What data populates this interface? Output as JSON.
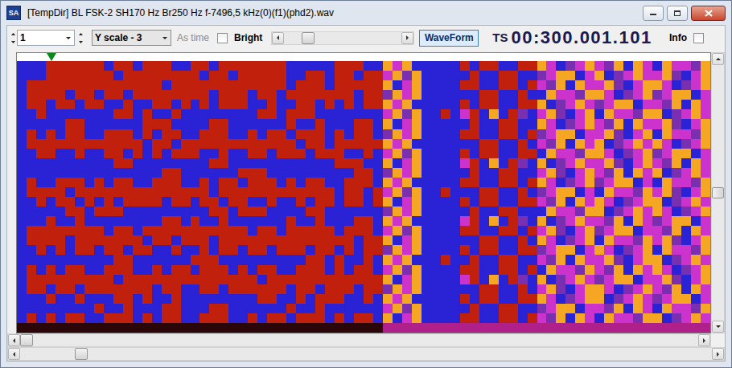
{
  "window": {
    "title": "[TempDir] BL FSK-2 SH170 Hz Br250 Hz f-7496,5 kHz(0)(f1)(phd2).wav",
    "app_logo": "SA"
  },
  "toolbar": {
    "channel": {
      "value": "1"
    },
    "scale": {
      "value": "Y scale - 3"
    },
    "as_time": {
      "label": "As time",
      "disabled": true
    },
    "bright": {
      "label": "Bright",
      "checked": false
    },
    "slider": {
      "level": 0.17
    },
    "waveform": {
      "label": "WaveForm",
      "selected": true
    },
    "ts": {
      "label": "TS",
      "value": "00:300.001.101"
    },
    "info": {
      "label": "Info",
      "checked": false
    }
  },
  "plot": {
    "marker": {
      "level": 0.05
    },
    "palette": {
      "R": "#c0200c",
      "B": "#2a23d6",
      "Y": "#f5a623",
      "M": "#cc33cc",
      "P": "#7a2fb0",
      "K": "#2a0608",
      "m": "#b0208a"
    },
    "rows": [
      "BBB RRRRR RBRRB RRRBB RRBRR RRRRR BBBBB RRRBB YMYB BBBB RBRRBBRR YMBPMY MPYBYM BYMMPY",
      "BBB RRRRR RRBRR RRRRR RBRRB RRRRR BBRRB RRBRR MYPY BBBB BRBBRRBB PMYYBM YBPMYM MYPBMY",
      "BRR RRRRR RRRRR RRBRR RRRRR RRRRR BRRRB RRRRR YBMY BBBB RRBBRRBR MPYBYM MYPBMY YMBPMY",
      "BRR RRBRR BRRBR RRRRR RRBRR RBRRB RRRRR RRBRR PYMY BBBB BBRRBBRB BYMMPY YMBPMY PMYYBM",
      "BRR BRRBR RBBRB BRRBR BRBRR RBBRB BRRBR BRBRR YMYB BBBB RBRRBBRR YBPMYM PMYYBM MPYBYM",
      "BBR BBBBB BBRRB RBBRB BBBBB BBRRB RRRBB BBBBB MYPY BBRB MRBYBRPB MYPBMY BYMMPY YBPMYM",
      "BBB BBRRB BBBBB RRRBB BBRRB BBBBB RBBRB BBRRB YBMY BBBB BRBBRRBB YMBPMY MPYBYM MYPBMY",
      "BRB RBRRB BRRRB RBRRB BRRRB BRBRR BRRRB RBRRB PYMY BBBB RRBBRRBR PMYYBM MYPBMY BYMMPY",
      "BRR RRRRR RRRRR BRRBR RRRRR RRRRR RBRRB RRRRR YMYB BBBB BBRRBBRB MPYBYM YBPMYM YMBPMY",
      "BBR RBBRB BRRBR BRBRR RBBRB BRRBR RRBRR RBBRB MYPY BBBB RBRRBBRR BYMMPY YMBPMY PMYYBM",
      "BBB BBBBB BBRRB BBBBB BBRRB BBBBB BBBBB RRRBB YBMY BBBB MRBYBRPB YBPMYM MYPBMY MPYBYM",
      "BBB BBBBB BBBBB BBRRB BBBBB RRRBB BBBBB BBRRB PYMY BBBB BRBBRRBB MYPBMY MPYBYM YBPMYM",
      "BRB BRRRB RBRRB BRRRB BRBRR BRRRB RBRRB BRRRB YMYB BBBB RRBBRRBR YMBPMY PMYYBM BYMMPY",
      "BRR RRBRR RRRRR RRRRR RRBRR RRRRR RRRRR BRRBR MYPY BBRB BBRRBBRB PMYYBM BYMMPY MYPBMY",
      "BBR BRRBR BRBRR RRBRR BRRBR RBBRB BRBRR BRRBR YBMY BBBB RBRRBBRR MPYBYM YMBPMY YBPMYM",
      "BBB BBRRB RRRBB BBBBB BBRRB RRRBB BBRRB BBBBB PYMY BBBB BRBBRRBB BYMMPY YBPMYM YMBPMY",
      "BBB RBBRB BBBBB BBRRB RBBRB BBBBB RBBRB BBRRB YMYB BBBB MRBYBRPB YBPMYM MPYBYM PMYYBM",
      "BRR RRRRR RBRRB RRRRR RRRRR RBRRB RRRRR BRRRB MYPY BBBB RRBBRRBR MYPBMY PMYYBM MPYBYM",
      "BRR RRBRR RRRRR BRRBR RRBRR RRRRR RRRRR RRBRR YBMY BBBB BBRRBBRB YMBPMY BYMMPY MYPBMY",
      "BBR BRBRR BRRBR RBBRB BRBRR BRRBR RRBRR BRBRR PYMY BBBB RBRRBBRR PMYYBM YMBPMY BYMMPY",
      "BBB BBBBB BBRRB BBBBB RRRBB BBBBB BBRRB RBBRB YMYB BBRB BRBBRRBB MPYBYM MYPBMY YBPMYM",
      "BRB RBRRB BRRRB BRBRR BRRRB RBRRB BRRRB RBRRB MYPY BBBB RRBBRRBR BYMMPY MPYBYM YMBPMY",
      "BRR RRRRR RRBRR RRRRR RRRRR RRBRR RRRRR RRRRR YBMY BBBB MRBYBRPB YBPMYM PMYYBM MYPBMY",
      "BRR BRRBR RRRRR RBRRB BRRBR RRRRR BRRBR RRBRR PYMY BBBB BBRRBBRB MYPBMY YMBPMY MPYBYM",
      "BBB RBBRB BBRRB RBBRB BBBBB BBRRB BRBRR RBBRB YMYB BBBB RBRRBBRR YMBPMY YBPMYM PMYYBM",
      "BBB BBBBB RBBRB BBRRB BBRRB BBBBB RBBRB BBBBB MYPY BBBB BRBBRRBB PMYYBM MPYBYM BYMMPY",
      "BRB RBRRB BRRRB RBRRB BRRRB BRBRR BRRRB RBRRB YBMY BBBB RRBBRRBR MPYBYM BYMMPY YBPMYM",
      "KKKKKKKKKK KKKKKKKKKK KKKKKKKKKK KKKKKKKK mmmmmmmmmm mmmmmmmmmm mmmmmmmmmm mmmm"
    ]
  },
  "vscroll": {
    "level": 0.5
  },
  "hscroll": {
    "level": 0.0
  },
  "hscroll2": {
    "level": 0.08
  }
}
